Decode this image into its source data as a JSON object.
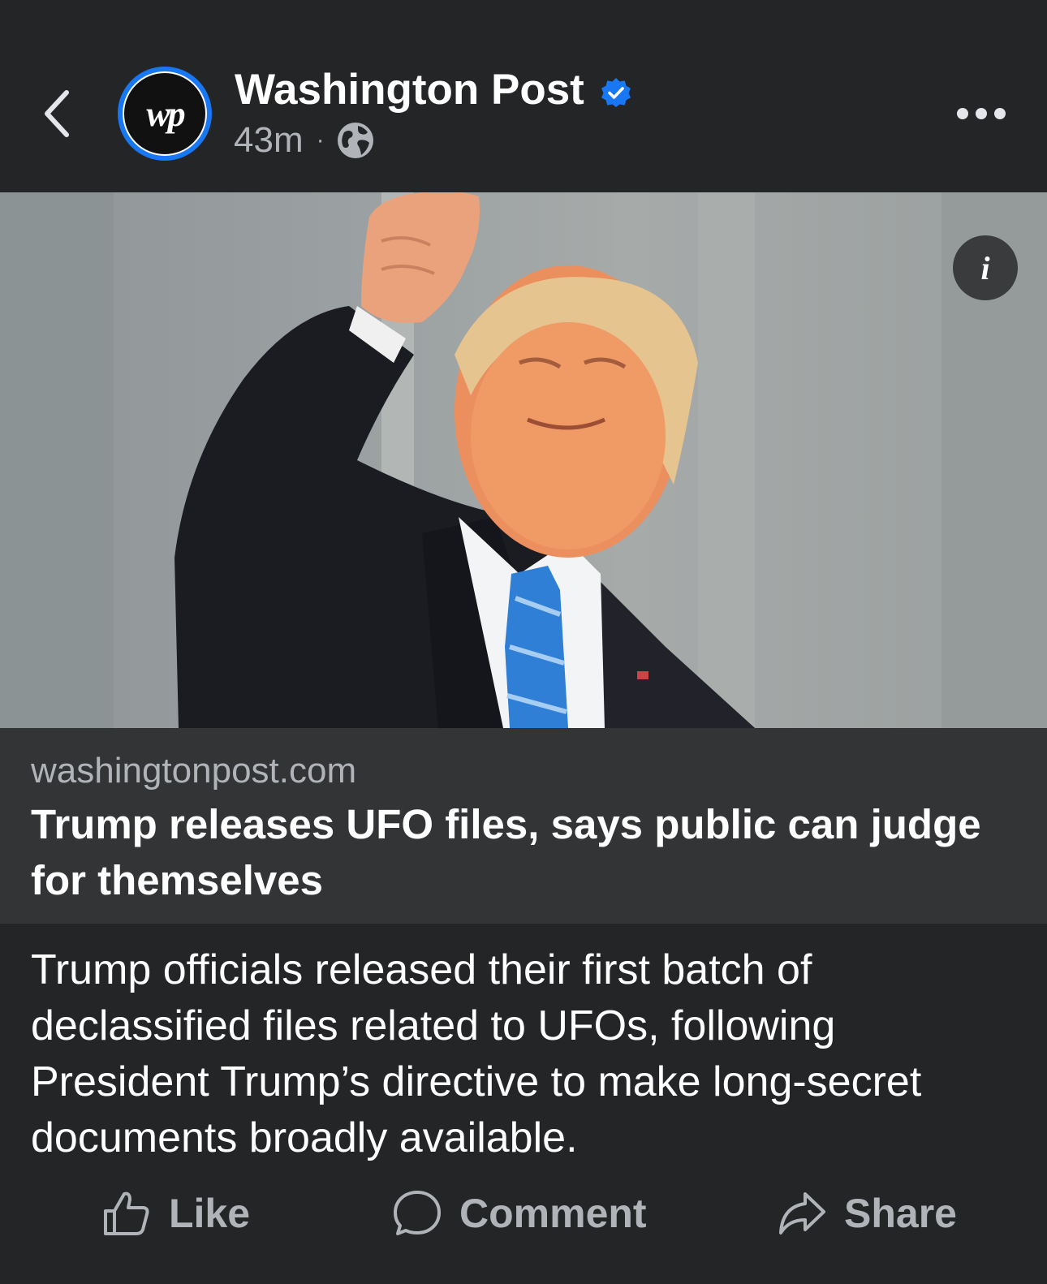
{
  "header": {
    "page_name": "Washington Post",
    "avatar_logo_text": "wp",
    "timestamp": "43m",
    "separator": "·",
    "back_icon": "chevron-left-icon",
    "more_icon": "more-horizontal-icon",
    "verified_icon": "verified-badge-icon",
    "privacy_icon": "globe-icon",
    "verified_color": "#1877f2"
  },
  "media": {
    "info_label": "i"
  },
  "link_card": {
    "domain": "washingtonpost.com",
    "title": "Trump releases UFO files, says public can judge for themselves"
  },
  "post": {
    "text": "Trump officials released their first batch of declassified files related to UFOs, following President Trump’s directive to make long-secret documents broadly available."
  },
  "actions": {
    "like": "Like",
    "comment": "Comment",
    "share": "Share"
  }
}
